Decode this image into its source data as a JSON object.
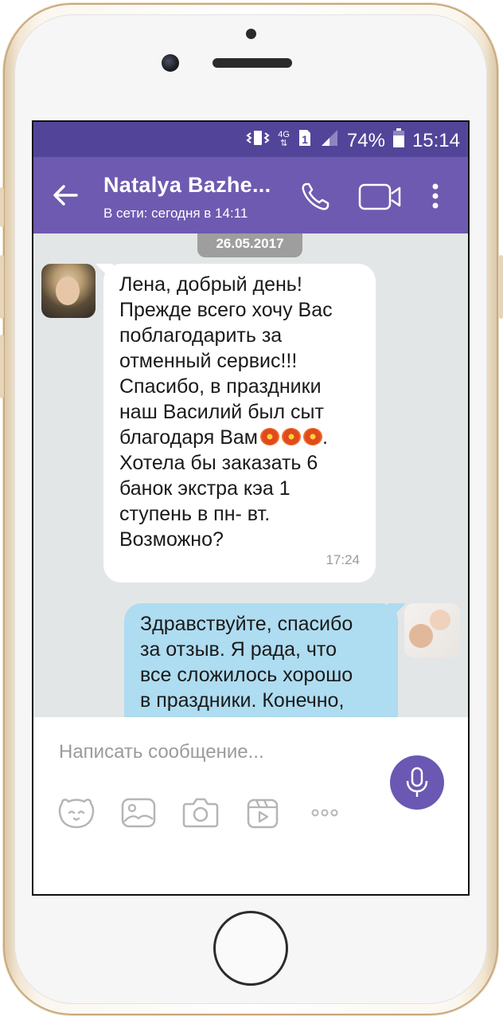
{
  "status_bar": {
    "battery": "74%",
    "time": "15:14",
    "network": "4G",
    "sim": "1",
    "icons": [
      "vibrate-icon",
      "data-arrows-icon",
      "sim-icon",
      "signal-icon",
      "battery-icon"
    ]
  },
  "header": {
    "contact_name": "Natalya Bazhe...",
    "contact_status": "В сети: сегодня в 14:11",
    "icons": [
      "back-arrow-icon",
      "phone-icon",
      "video-call-icon",
      "more-vert-icon"
    ]
  },
  "chat": {
    "date": "26.05.2017",
    "messages": [
      {
        "direction": "incoming",
        "lines": [
          "Лена, добрый день!",
          "Прежде всего хочу Вас",
          "поблагодарить за",
          "отменный сервис!!!",
          "Спасибо, в праздники",
          "наш Василий был сыт",
          "благодаря Вам",
          "Хотела бы заказать 6",
          "банок экстра кэа 1",
          "ступень в пн- вт.",
          "Возможно?"
        ],
        "emoji_after_line_7": [
          "flower-icon",
          "flower-icon",
          "flower-icon"
        ],
        "line_7_suffix": ".",
        "time": "17:24"
      },
      {
        "direction": "outgoing",
        "lines": [
          "Здравствуйте, спасибо",
          "за отзыв.  Я рада, что",
          "все сложилось хорошо",
          "в праздники.  Конечно,"
        ]
      }
    ]
  },
  "composer": {
    "placeholder": "Написать сообщение...",
    "tools": [
      "sticker-icon",
      "gallery-icon",
      "camera-icon",
      "video-icon",
      "more-icon"
    ],
    "send_icon": "microphone-icon"
  },
  "colors": {
    "status_bar": "#524599",
    "app_bar": "#6e5ab0",
    "chat_bg": "#e3e6e7",
    "incoming_bubble": "#ffffff",
    "outgoing_bubble": "#aedcf0",
    "mic_button": "#6a58b2"
  }
}
